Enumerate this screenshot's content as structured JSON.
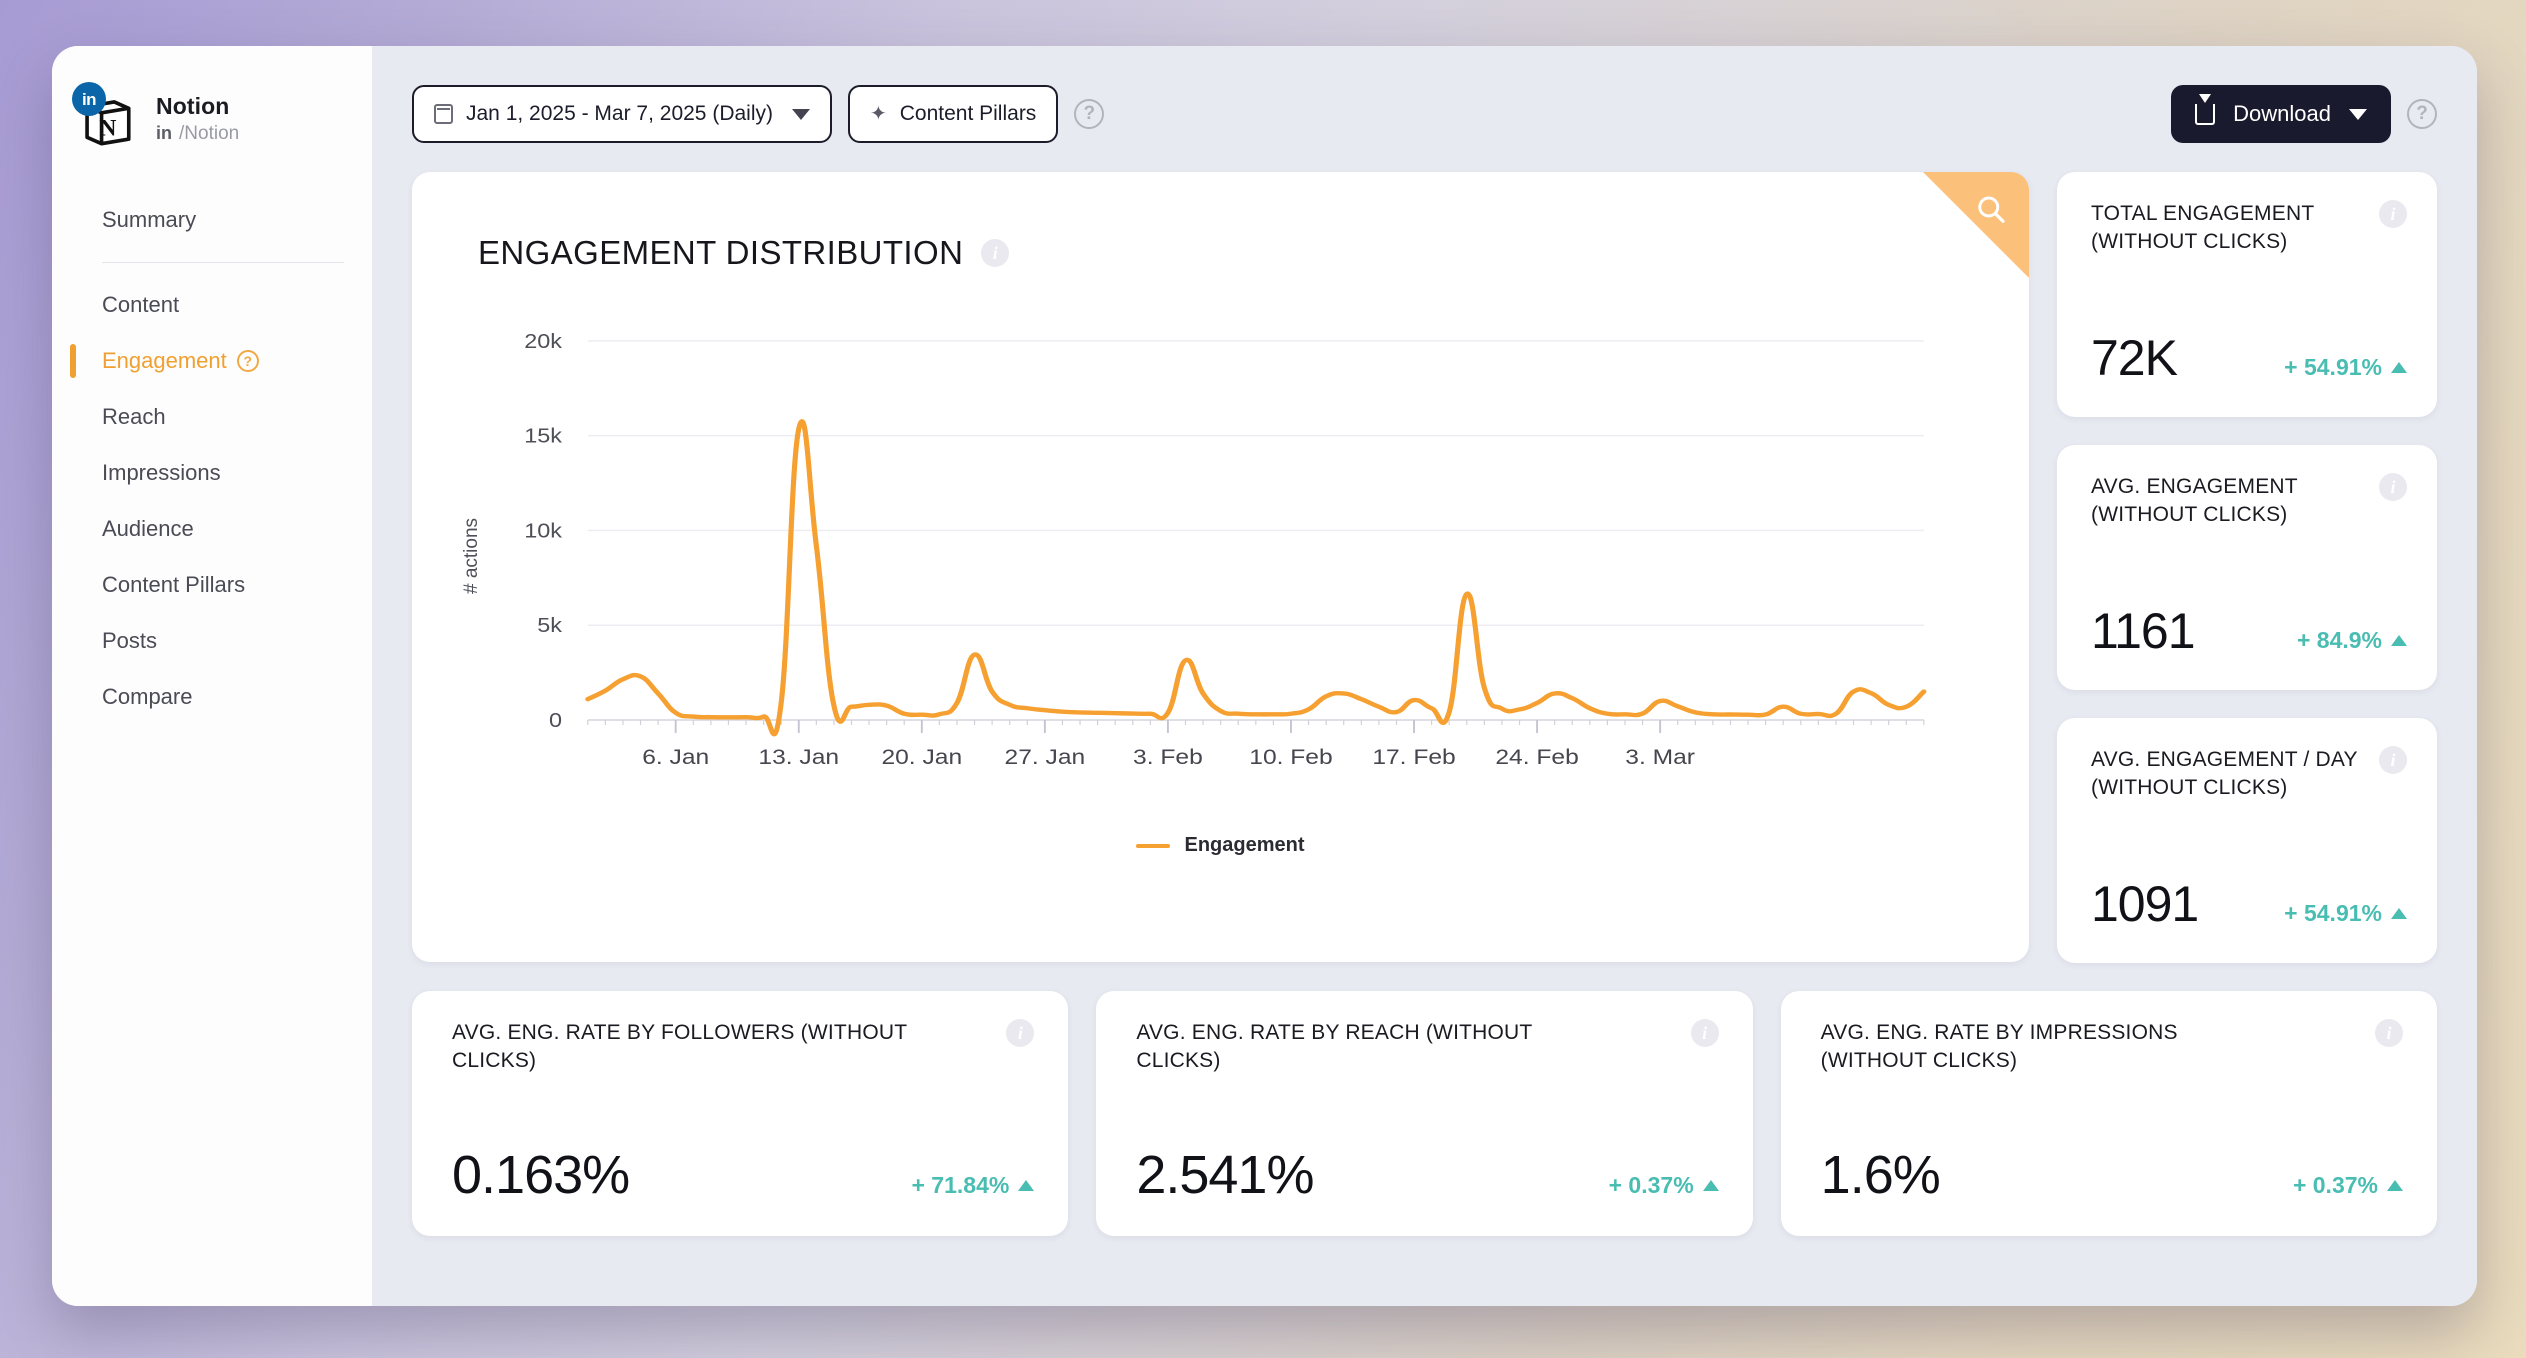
{
  "sidebar": {
    "brand": {
      "name": "Notion",
      "network_icon": "linkedin-icon",
      "network_label": "in",
      "handle": "/Notion",
      "avatar_icon": "notion-logo-icon"
    },
    "items": [
      {
        "label": "Summary",
        "active": false,
        "has_help": false
      },
      {
        "label": "Content",
        "active": false,
        "has_help": false
      },
      {
        "label": "Engagement",
        "active": true,
        "has_help": true
      },
      {
        "label": "Reach",
        "active": false,
        "has_help": false
      },
      {
        "label": "Impressions",
        "active": false,
        "has_help": false
      },
      {
        "label": "Audience",
        "active": false,
        "has_help": false
      },
      {
        "label": "Content Pillars",
        "active": false,
        "has_help": false
      },
      {
        "label": "Posts",
        "active": false,
        "has_help": false
      },
      {
        "label": "Compare",
        "active": false,
        "has_help": false
      }
    ]
  },
  "toolbar": {
    "date_range": "Jan 1, 2025 - Mar 7, 2025 (Daily)",
    "date_icon": "calendar-icon",
    "content_pillars": "Content Pillars",
    "content_pillars_icon": "sparkle-icon",
    "help_icon": "question-mark-icon",
    "help_label": "?",
    "download": "Download",
    "download_icon": "download-icon",
    "download_help_label": "?"
  },
  "chart_card": {
    "title": "ENGAGEMENT DISTRIBUTION",
    "info_icon": "info-icon",
    "info_label": "i",
    "search_icon": "search-icon"
  },
  "chart_data": {
    "type": "line",
    "title": "ENGAGEMENT DISTRIBUTION",
    "xlabel": "",
    "ylabel": "# actions",
    "ylim": [
      0,
      21000
    ],
    "ytick_labels": [
      "0",
      "5k",
      "10k",
      "15k",
      "20k"
    ],
    "ytick_values": [
      0,
      5000,
      10000,
      15000,
      20000
    ],
    "xtick_labels": [
      "6. Jan",
      "13. Jan",
      "20. Jan",
      "27. Jan",
      "3. Feb",
      "10. Feb",
      "17. Feb",
      "24. Feb",
      "3. Mar"
    ],
    "xtick_indices": [
      5,
      12,
      19,
      26,
      33,
      40,
      47,
      54,
      61
    ],
    "grid": true,
    "legend_position": "bottom",
    "accent_color": "#f5a030",
    "series": [
      {
        "name": "Engagement",
        "color": "#f5a030",
        "values": [
          1100,
          1550,
          2150,
          2300,
          1400,
          380,
          180,
          150,
          140,
          150,
          180,
          900,
          15350,
          9200,
          760,
          700,
          800,
          760,
          330,
          280,
          300,
          900,
          3450,
          1500,
          800,
          620,
          520,
          440,
          400,
          380,
          360,
          340,
          330,
          380,
          3150,
          1400,
          480,
          330,
          300,
          300,
          330,
          560,
          1250,
          1400,
          1100,
          700,
          420,
          1050,
          620,
          420,
          6650,
          1700,
          600,
          560,
          900,
          1400,
          1150,
          620,
          330,
          300,
          340,
          1000,
          720,
          400,
          300,
          290,
          280,
          290,
          700,
          330,
          320,
          330,
          1500,
          1420,
          800,
          700,
          1500
        ]
      }
    ],
    "legend": [
      {
        "label": "Engagement",
        "color": "#f5a030"
      }
    ]
  },
  "kpi_cards": [
    {
      "label": "TOTAL ENGAGEMENT (WITHOUT CLICKS)",
      "value": "72K",
      "delta": "+ 54.91%",
      "delta_direction": "up",
      "delta_color": "#49bdb1",
      "info_label": "i"
    },
    {
      "label": "AVG. ENGAGEMENT (WITHOUT CLICKS)",
      "value": "1161",
      "delta": "+ 84.9%",
      "delta_direction": "up",
      "delta_color": "#49bdb1",
      "info_label": "i"
    },
    {
      "label": "AVG. ENGAGEMENT / DAY (WITHOUT CLICKS)",
      "value": "1091",
      "delta": "+ 54.91%",
      "delta_direction": "up",
      "delta_color": "#49bdb1",
      "info_label": "i"
    }
  ],
  "rate_cards": [
    {
      "label": "AVG. ENG. RATE BY FOLLOWERS (WITHOUT CLICKS)",
      "value": "0.163%",
      "delta": "+ 71.84%",
      "delta_direction": "up",
      "delta_color": "#49bdb1",
      "info_label": "i"
    },
    {
      "label": "AVG. ENG. RATE BY REACH (WITHOUT CLICKS)",
      "value": "2.541%",
      "delta": "+ 0.37%",
      "delta_direction": "up",
      "delta_color": "#49bdb1",
      "info_label": "i"
    },
    {
      "label": "AVG. ENG. RATE BY IMPRESSIONS (WITHOUT CLICKS)",
      "value": "1.6%",
      "delta": "+ 0.37%",
      "delta_direction": "up",
      "delta_color": "#49bdb1",
      "info_label": "i"
    }
  ]
}
